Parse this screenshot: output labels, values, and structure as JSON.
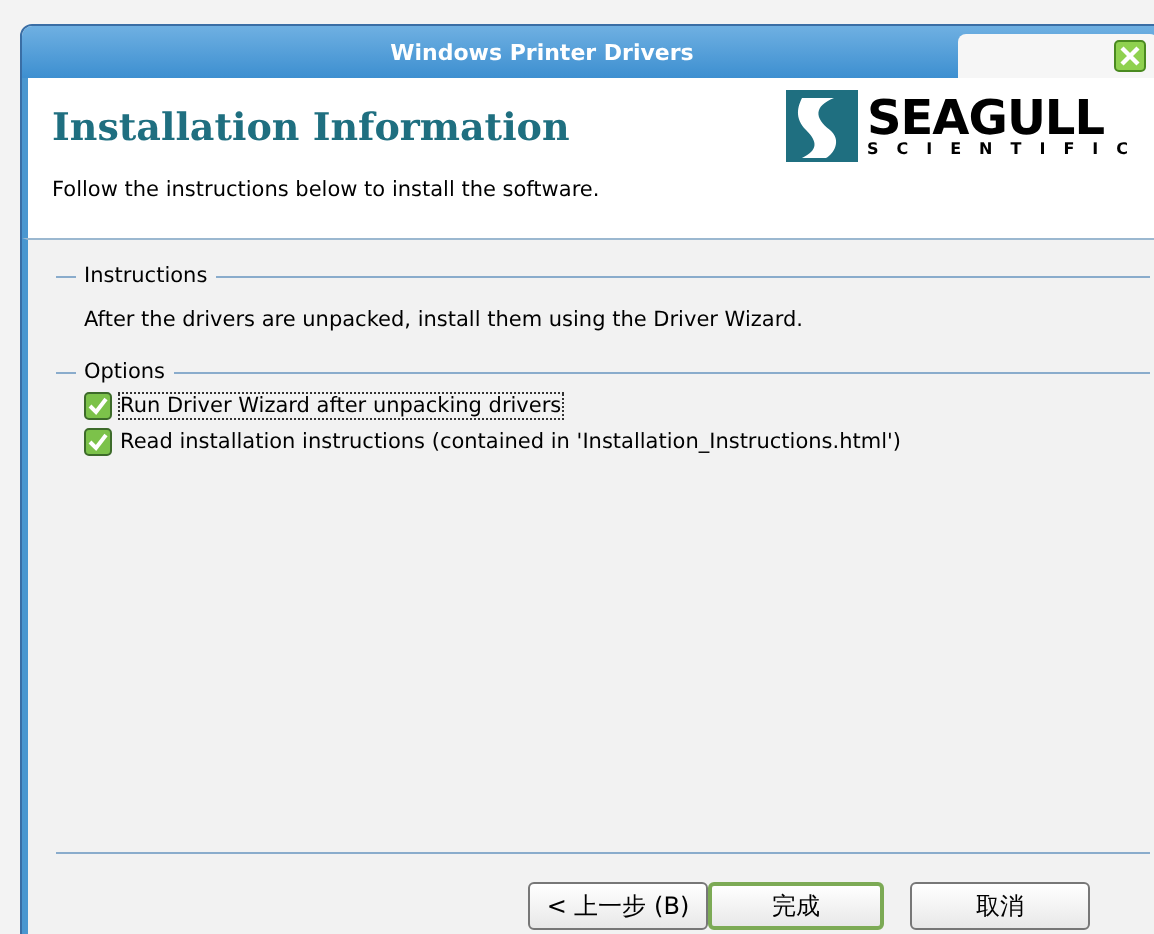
{
  "window": {
    "title": "Windows Printer Drivers"
  },
  "header": {
    "title": "Installation Information",
    "subtitle": "Follow the instructions below to install the software.",
    "logo": {
      "name": "SEAGULL",
      "tagline": "SCIENTIFIC"
    }
  },
  "instructions": {
    "heading": "Instructions",
    "text": "After the drivers are unpacked, install them using the Driver Wizard."
  },
  "options": {
    "heading": "Options",
    "items": [
      {
        "label": "Run Driver Wizard after unpacking drivers",
        "checked": true,
        "focused": true
      },
      {
        "label": "Read installation instructions (contained in 'Installation_Instructions.html')",
        "checked": true,
        "focused": false
      }
    ]
  },
  "buttons": [
    {
      "label": "< 上一步 (B)",
      "kind": "back"
    },
    {
      "label": "完成",
      "kind": "default"
    },
    {
      "label": "取消",
      "kind": "cancel"
    }
  ]
}
